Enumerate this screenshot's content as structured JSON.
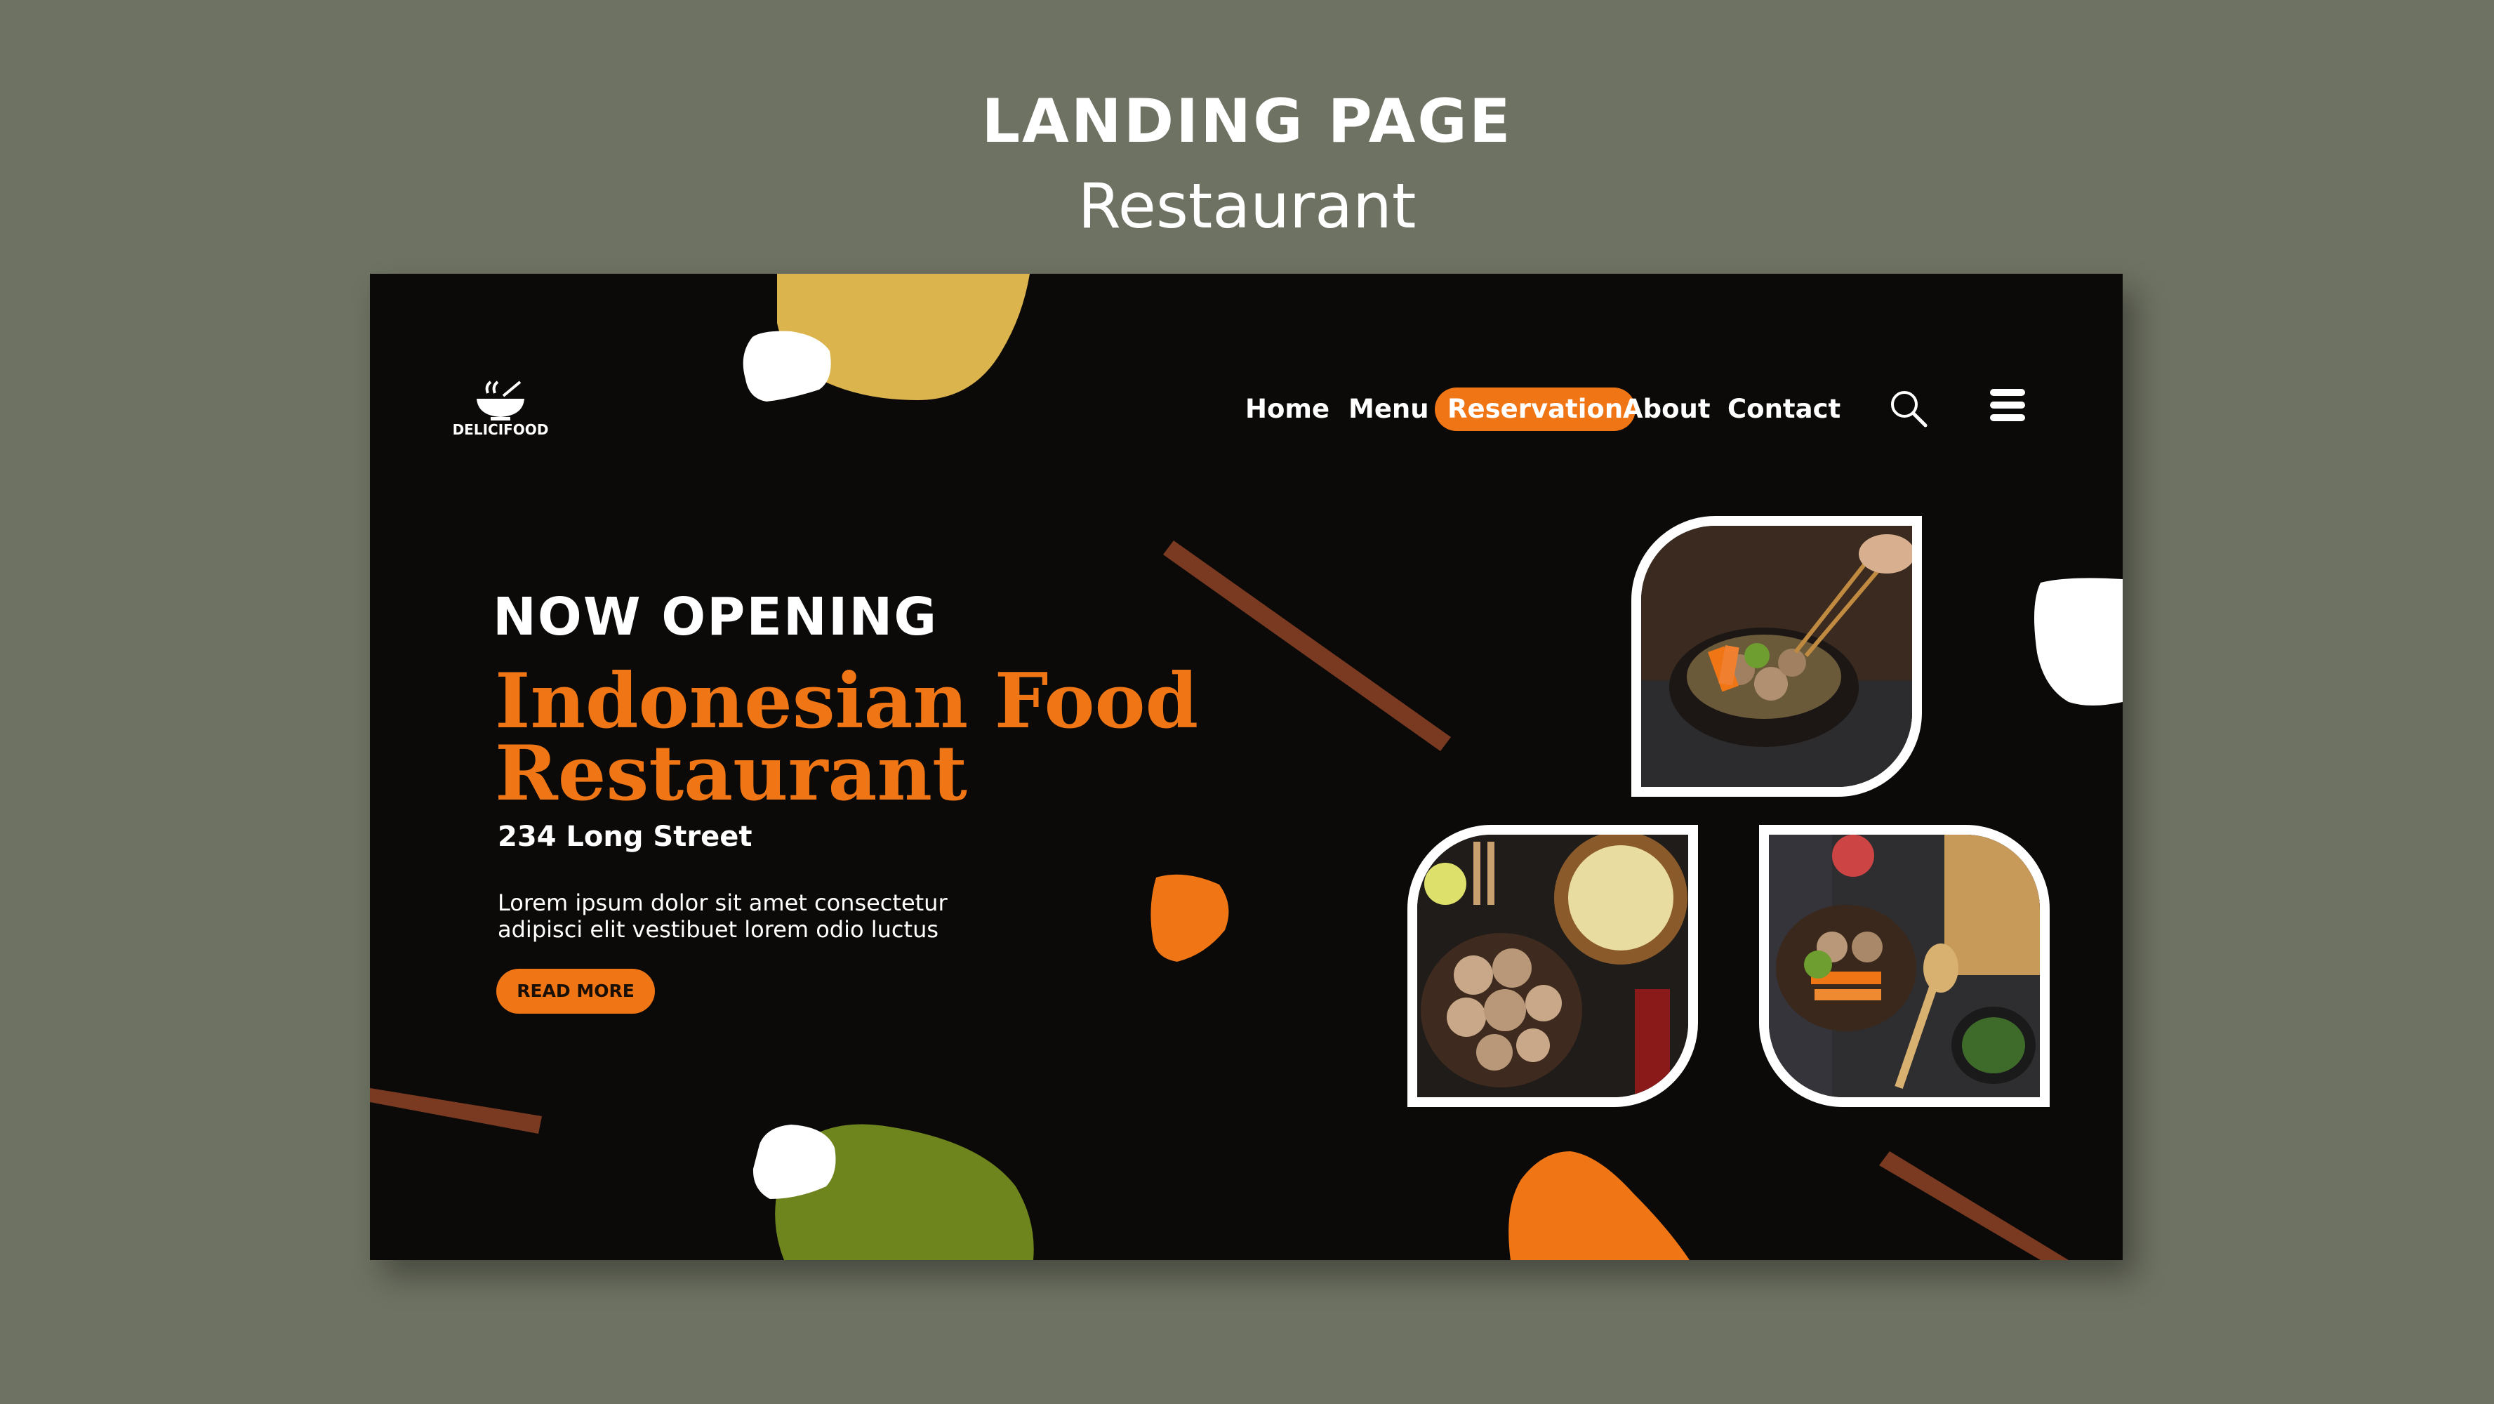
{
  "header": {
    "title": "LANDING PAGE",
    "subtitle": "Restaurant"
  },
  "brand": {
    "logo_text": "DELICIFOOD",
    "icon": "bowl-icon"
  },
  "nav": {
    "items": [
      {
        "label": "Home"
      },
      {
        "label": "Menu"
      },
      {
        "label": "Reservation",
        "active": true
      },
      {
        "label": "About"
      },
      {
        "label": "Contact"
      }
    ],
    "search_icon": "search-icon",
    "menu_icon": "hamburger-menu-icon"
  },
  "hero": {
    "kicker": "NOW OPENING",
    "title_line1": "Indonesian Food",
    "title_line2": "Restaurant",
    "address": "234  Long Street",
    "body_line1": "Lorem ipsum dolor sit amet consectetur",
    "body_line2": "adipisci elit vestibuet lorem odio luctus",
    "cta_label": "READ MORE"
  },
  "colors": {
    "background": "#6e7262",
    "page": "#0c0a08",
    "accent": "#f07515",
    "mustard": "#dcb44e",
    "olive": "#6e841c",
    "chopstick": "#7a3a22"
  }
}
